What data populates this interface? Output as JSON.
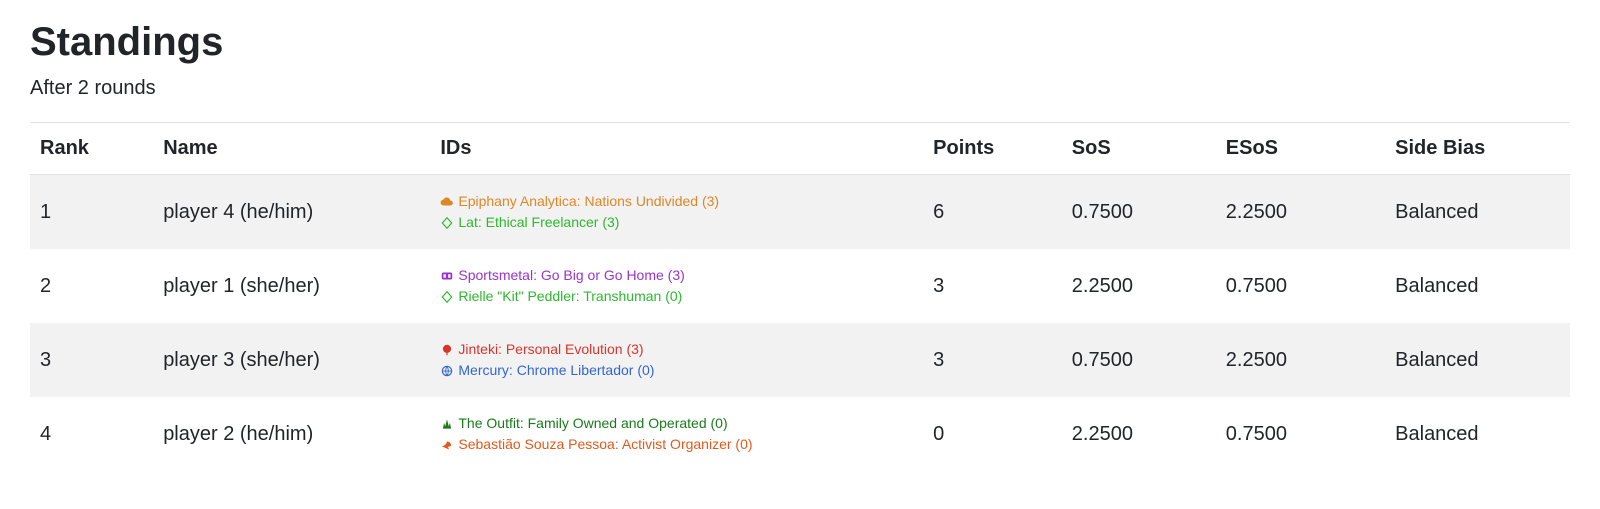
{
  "title": "Standings",
  "subtitle": "After 2 rounds",
  "columns": {
    "rank": "Rank",
    "name": "Name",
    "ids": "IDs",
    "points": "Points",
    "sos": "SoS",
    "esos": "ESoS",
    "side_bias": "Side Bias"
  },
  "rows": [
    {
      "rank": "1",
      "name": "player 4 (he/him)",
      "corp": {
        "name": "Epiphany Analytica: Nations Undivided (3)",
        "color": "#e08626",
        "icon": "cloud"
      },
      "runner": {
        "name": "Lat: Ethical Freelancer (3)",
        "color": "#2db82d",
        "icon": "diamond"
      },
      "points": "6",
      "sos": "0.7500",
      "esos": "2.2500",
      "side_bias": "Balanced"
    },
    {
      "rank": "2",
      "name": "player 1 (she/her)",
      "corp": {
        "name": "Sportsmetal: Go Big or Go Home (3)",
        "color": "#9933cc",
        "icon": "hb"
      },
      "runner": {
        "name": "Rielle \"Kit\" Peddler: Transhuman (0)",
        "color": "#2db82d",
        "icon": "diamond"
      },
      "points": "3",
      "sos": "2.2500",
      "esos": "0.7500",
      "side_bias": "Balanced"
    },
    {
      "rank": "3",
      "name": "player 3 (she/her)",
      "corp": {
        "name": "Jinteki: Personal Evolution (3)",
        "color": "#d9342b",
        "icon": "tree"
      },
      "runner": {
        "name": "Mercury: Chrome Libertador (0)",
        "color": "#3366cc",
        "icon": "globe"
      },
      "points": "3",
      "sos": "0.7500",
      "esos": "2.2500",
      "side_bias": "Balanced"
    },
    {
      "rank": "4",
      "name": "player 2 (he/him)",
      "corp": {
        "name": "The Outfit: Family Owned and Operated (0)",
        "color": "#1a7a1a",
        "icon": "claw"
      },
      "runner": {
        "name": "Sebastião Souza Pessoa: Activist Organizer (0)",
        "color": "#e25a1b",
        "icon": "bird"
      },
      "points": "0",
      "sos": "2.2500",
      "esos": "0.7500",
      "side_bias": "Balanced"
    }
  ]
}
